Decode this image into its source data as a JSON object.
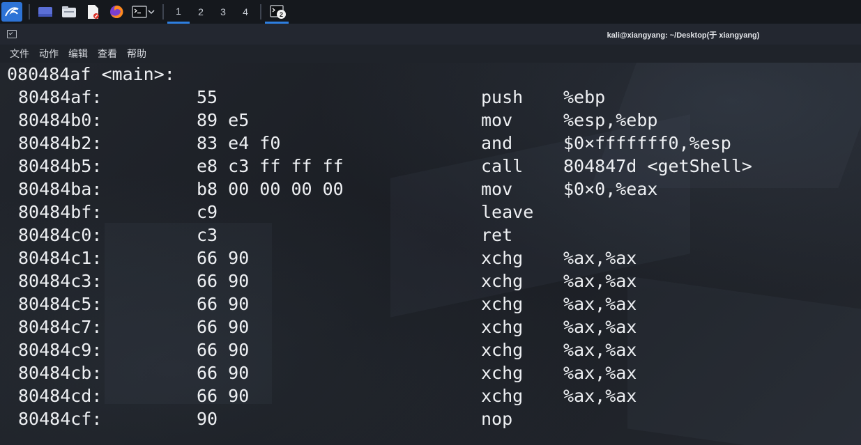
{
  "taskbar": {
    "workspaces": [
      "1",
      "2",
      "3",
      "4"
    ],
    "terminal_badge": "2"
  },
  "window": {
    "title": "kali@xiangyang: ~/Desktop(于 xiangyang)"
  },
  "menu": [
    "文件",
    "动作",
    "编辑",
    "查看",
    "帮助"
  ],
  "terminal": {
    "header": "080484af <main>:",
    "rows": [
      {
        "addr": "80484af:",
        "bytes": "55",
        "op": "push",
        "args": "%ebp"
      },
      {
        "addr": "80484b0:",
        "bytes": "89 e5",
        "op": "mov",
        "args": "%esp,%ebp"
      },
      {
        "addr": "80484b2:",
        "bytes": "83 e4 f0",
        "op": "and",
        "args": "$0×fffffff0,%esp"
      },
      {
        "addr": "80484b5:",
        "bytes": "e8 c3 ff ff ff",
        "op": "call",
        "args": "804847d <getShell>"
      },
      {
        "addr": "80484ba:",
        "bytes": "b8 00 00 00 00",
        "op": "mov",
        "args": "$0×0,%eax"
      },
      {
        "addr": "80484bf:",
        "bytes": "c9",
        "op": "leave",
        "args": ""
      },
      {
        "addr": "80484c0:",
        "bytes": "c3",
        "op": "ret",
        "args": ""
      },
      {
        "addr": "80484c1:",
        "bytes": "66 90",
        "op": "xchg",
        "args": "%ax,%ax"
      },
      {
        "addr": "80484c3:",
        "bytes": "66 90",
        "op": "xchg",
        "args": "%ax,%ax"
      },
      {
        "addr": "80484c5:",
        "bytes": "66 90",
        "op": "xchg",
        "args": "%ax,%ax"
      },
      {
        "addr": "80484c7:",
        "bytes": "66 90",
        "op": "xchg",
        "args": "%ax,%ax"
      },
      {
        "addr": "80484c9:",
        "bytes": "66 90",
        "op": "xchg",
        "args": "%ax,%ax"
      },
      {
        "addr": "80484cb:",
        "bytes": "66 90",
        "op": "xchg",
        "args": "%ax,%ax"
      },
      {
        "addr": "80484cd:",
        "bytes": "66 90",
        "op": "xchg",
        "args": "%ax,%ax"
      },
      {
        "addr": "80484cf:",
        "bytes": "90",
        "op": "nop",
        "args": ""
      }
    ]
  },
  "colors": {
    "accent": "#2e7fe0",
    "terminal_text": "#eef0f3"
  },
  "icons": {
    "kali": "kali-menu-icon",
    "desktop": "show-desktop-icon",
    "files": "file-manager-icon",
    "editor": "text-editor-icon",
    "browser": "firefox-icon",
    "terminal": "terminal-icon"
  }
}
